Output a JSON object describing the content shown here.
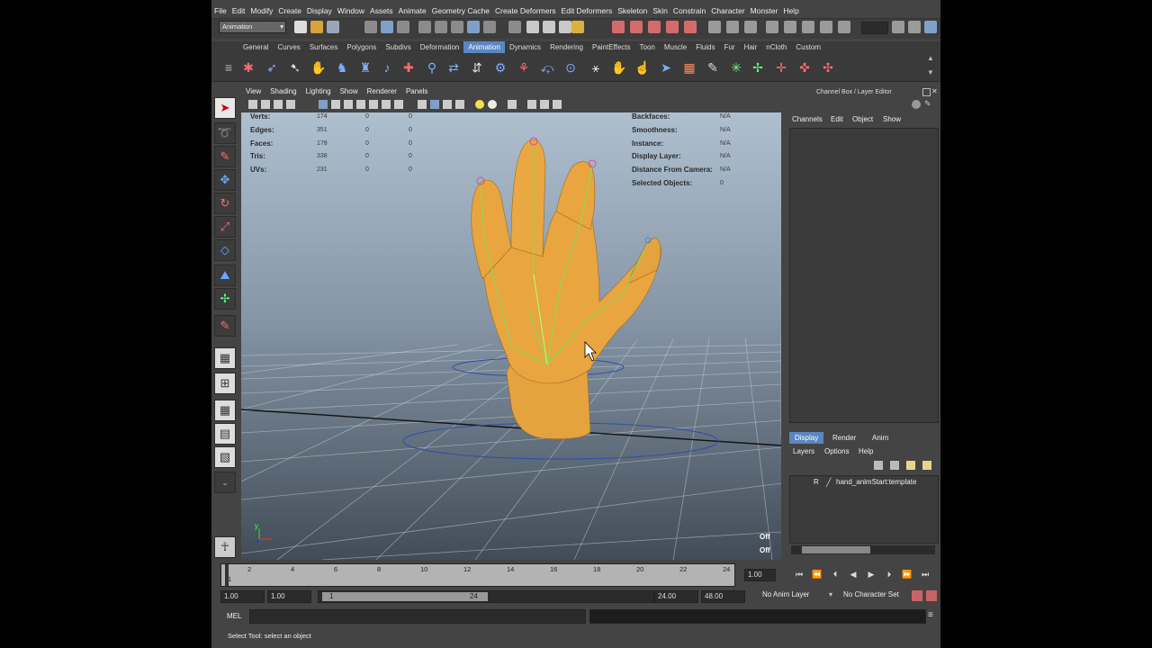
{
  "menus": [
    "File",
    "Edit",
    "Modify",
    "Create",
    "Display",
    "Window",
    "Assets",
    "Animate",
    "Geometry Cache",
    "Create Deformers",
    "Edit Deformers",
    "Skeleton",
    "Skin",
    "Constrain",
    "Character",
    "Monster",
    "Help"
  ],
  "status_line": {
    "mode": "Animation"
  },
  "shelf_tabs": [
    "General",
    "Curves",
    "Surfaces",
    "Polygons",
    "Subdivs",
    "Deformation",
    "Animation",
    "Dynamics",
    "Rendering",
    "PaintEffects",
    "Toon",
    "Muscle",
    "Fluids",
    "Fur",
    "Hair",
    "nCloth",
    "Custom"
  ],
  "shelf_active_tab": "Animation",
  "viewport": {
    "menu": [
      "View",
      "Shading",
      "Lighting",
      "Show",
      "Renderer",
      "Panels"
    ],
    "hud_left": [
      {
        "label": "Verts:",
        "v1": "174",
        "v2": "0",
        "v3": "0"
      },
      {
        "label": "Edges:",
        "v1": "351",
        "v2": "0",
        "v3": "0"
      },
      {
        "label": "Faces:",
        "v1": "178",
        "v2": "0",
        "v3": "0"
      },
      {
        "label": "Tris:",
        "v1": "338",
        "v2": "0",
        "v3": "0"
      },
      {
        "label": "UVs:",
        "v1": "231",
        "v2": "0",
        "v3": "0"
      }
    ],
    "hud_right": [
      {
        "label": "Backfaces:",
        "value": "N/A"
      },
      {
        "label": "Smoothness:",
        "value": "N/A"
      },
      {
        "label": "Instance:",
        "value": "N/A"
      },
      {
        "label": "Display Layer:",
        "value": "N/A"
      },
      {
        "label": "Distance From Camera:",
        "value": "N/A"
      },
      {
        "label": "Selected Objects:",
        "value": "0"
      }
    ],
    "hud_bottom": [
      "Off",
      "Off"
    ],
    "axis_y": "y"
  },
  "channel_box": {
    "title": "Channel Box / Layer Editor",
    "menu": [
      "Channels",
      "Edit",
      "Object",
      "Show"
    ],
    "layer_tabs": [
      "Display",
      "Render",
      "Anim"
    ],
    "layer_active_tab": "Display",
    "layer_menu": [
      "Layers",
      "Options",
      "Help"
    ],
    "layer": {
      "flag": "R",
      "name": "hand_animStart:template"
    }
  },
  "timeline": {
    "ticks": [
      "1",
      "2",
      "4",
      "6",
      "8",
      "10",
      "12",
      "14",
      "16",
      "18",
      "20",
      "22",
      "24"
    ],
    "current_time": "1.00"
  },
  "range": {
    "start": "1.00",
    "playback_start": "1.00",
    "slider_start": "1",
    "slider_end": "24",
    "playback_end": "24.00",
    "end": "48.00",
    "anim_layer": "No Anim Layer",
    "character_set": "No Character Set"
  },
  "command_line": {
    "lang": "MEL"
  },
  "help_line": "Select Tool: select an object"
}
